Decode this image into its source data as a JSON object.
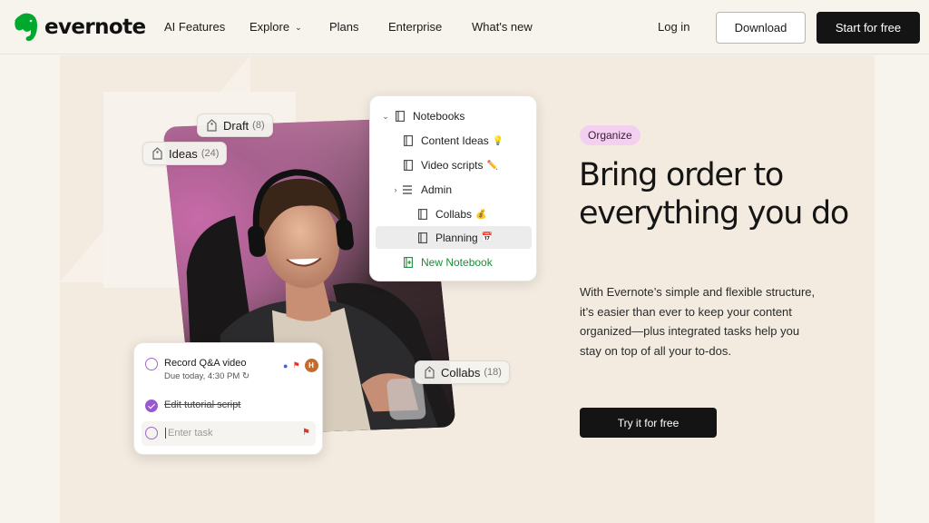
{
  "brand": {
    "name": "evernote",
    "color": "#00a82d"
  },
  "nav": {
    "items": [
      {
        "label": "AI Features"
      },
      {
        "label": "Explore",
        "has_dropdown": true
      },
      {
        "label": "Plans"
      },
      {
        "label": "Enterprise"
      },
      {
        "label": "What's new"
      }
    ],
    "login": "Log in",
    "download": "Download",
    "start": "Start for free"
  },
  "hero": {
    "badge": "Organize",
    "badge_color": "#f3d0f0",
    "headline": "Bring order to everything you do",
    "body": "With Evernote’s simple and flexible structure, it’s easier than ever to keep your content organized—plus integrated tasks help you stay on top of all your to-dos.",
    "cta": "Try it for free"
  },
  "chips": {
    "draft": {
      "label": "Draft",
      "count": "(8)"
    },
    "ideas": {
      "label": "Ideas",
      "count": "(24)"
    },
    "collabs": {
      "label": "Collabs",
      "count": "(18)"
    }
  },
  "notebooks": {
    "header": "Notebooks",
    "items": [
      {
        "label": "Content Ideas",
        "emoji": "💡"
      },
      {
        "label": "Video scripts",
        "emoji": "✏️"
      },
      {
        "label": "Admin",
        "icon": "stack-icon"
      },
      {
        "label": "Collabs",
        "emoji": "💰"
      },
      {
        "label": "Planning",
        "emoji": "📅",
        "selected": true
      }
    ],
    "new_notebook": "New Notebook"
  },
  "tasks": {
    "items": [
      {
        "title": "Record Q&A video",
        "due": "Due today, 4:30 PM",
        "done": false,
        "assignee": "H"
      },
      {
        "title": "Edit tutorial script",
        "done": true
      }
    ],
    "input_placeholder": "Enter task"
  }
}
